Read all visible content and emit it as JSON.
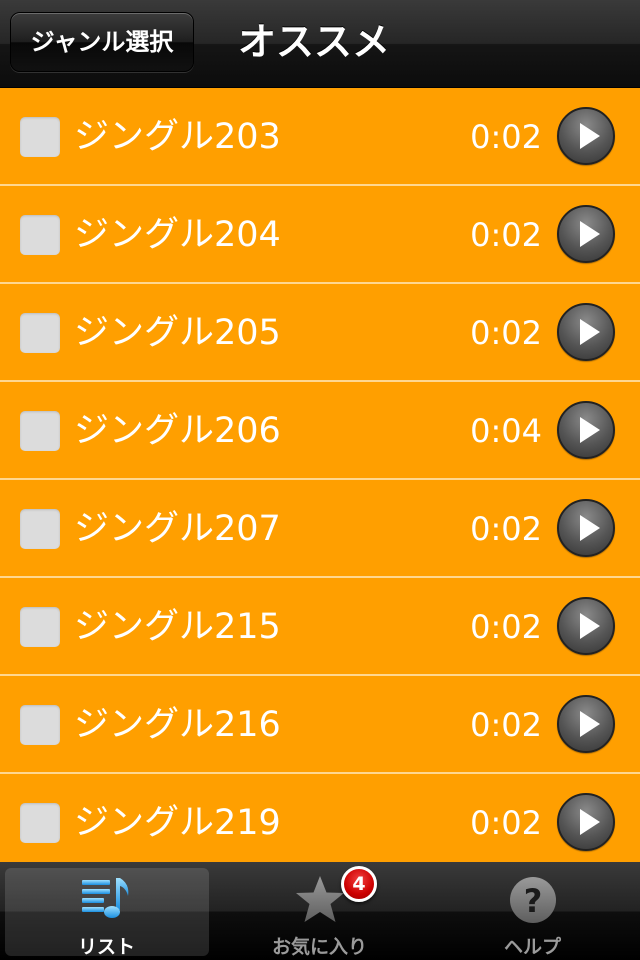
{
  "navbar": {
    "back_label": "ジャンル選択",
    "title": "オススメ"
  },
  "list": {
    "items": [
      {
        "title": "ジングル203",
        "duration": "0:02"
      },
      {
        "title": "ジングル204",
        "duration": "0:02"
      },
      {
        "title": "ジングル205",
        "duration": "0:02"
      },
      {
        "title": "ジングル206",
        "duration": "0:04"
      },
      {
        "title": "ジングル207",
        "duration": "0:02"
      },
      {
        "title": "ジングル215",
        "duration": "0:02"
      },
      {
        "title": "ジングル216",
        "duration": "0:02"
      },
      {
        "title": "ジングル219",
        "duration": "0:02"
      }
    ]
  },
  "tabbar": {
    "tabs": [
      {
        "label": "リスト",
        "icon": "music-list-icon",
        "selected": true
      },
      {
        "label": "お気に入り",
        "icon": "star-icon",
        "selected": false
      },
      {
        "label": "ヘルプ",
        "icon": "help-icon",
        "selected": false
      }
    ],
    "favorites_badge": "4"
  },
  "colors": {
    "accent": "#ff9f00",
    "row_separator": "#ffd790",
    "badge": "#cc0000"
  }
}
